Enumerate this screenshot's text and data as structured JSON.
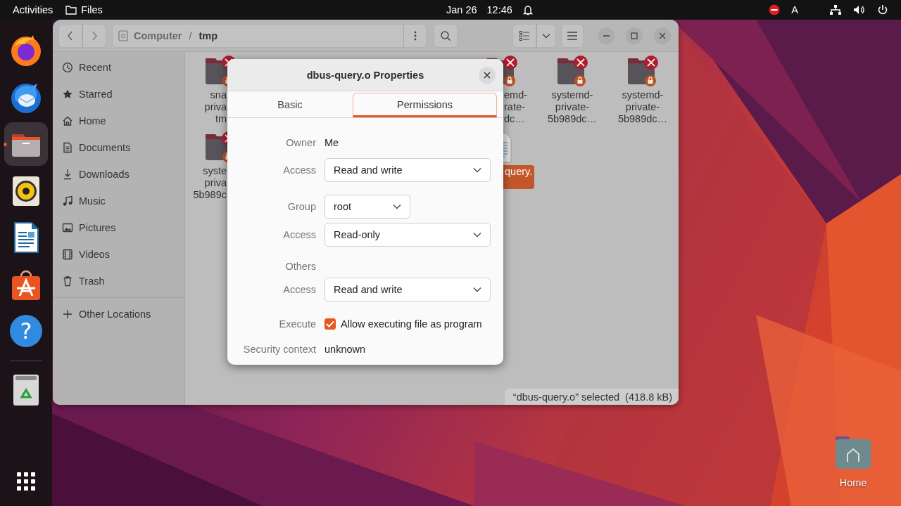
{
  "top_bar": {
    "activities": "Activities",
    "app_name": "Files",
    "date": "Jan 26",
    "time": "12:46",
    "input_source": "A"
  },
  "dock": {
    "apps": [
      {
        "kind": "firefox",
        "running": false,
        "focused": false
      },
      {
        "kind": "thunderbird",
        "running": false,
        "focused": false
      },
      {
        "kind": "files",
        "running": true,
        "focused": true
      },
      {
        "kind": "rhythmbox",
        "running": false,
        "focused": false
      },
      {
        "kind": "writer",
        "running": false,
        "focused": false
      },
      {
        "kind": "software",
        "running": false,
        "focused": false
      },
      {
        "kind": "help",
        "glyph": "?",
        "running": false,
        "focused": false
      }
    ],
    "trash": {
      "kind": "trash",
      "running": false,
      "focused": false
    }
  },
  "files_window": {
    "path": {
      "crumbs": [
        "Computer",
        "tmp"
      ],
      "separator": "/"
    },
    "sidebar": [
      {
        "label": "Recent"
      },
      {
        "label": "Starred"
      },
      {
        "label": "Home"
      },
      {
        "label": "Documents"
      },
      {
        "label": "Downloads"
      },
      {
        "label": "Music"
      },
      {
        "label": "Pictures"
      },
      {
        "label": "Videos"
      },
      {
        "label": "Trash"
      }
    ],
    "other_locations": {
      "label": "Other Locations"
    },
    "items": [
      {
        "kind": "folder",
        "lines": [
          "sna",
          "priva",
          "tm"
        ],
        "selected": false
      },
      {
        "kind": "folder",
        "lines": [
          "emd-",
          "rate-",
          "dc…"
        ],
        "selected": false
      },
      {
        "kind": "folder",
        "lines": [
          "systemd-",
          "private-",
          "5b989dc…"
        ],
        "selected": false
      },
      {
        "kind": "folder",
        "lines": [
          "systemd-",
          "private-",
          "5b989dc…"
        ],
        "selected": false
      },
      {
        "kind": "folder",
        "lines": [
          "syste",
          "priva",
          "5b989c"
        ],
        "selected": false
      },
      {
        "kind": "document",
        "lines": [
          "query."
        ],
        "selected": true
      }
    ],
    "status": "“dbus-query.o” selected  (418.8 kB)"
  },
  "dialog": {
    "title": "dbus-query.o Properties",
    "tabs": [
      {
        "label": "Basic",
        "selected": false
      },
      {
        "label": "Permissions",
        "selected": true
      }
    ],
    "sections": [
      {
        "rows": [
          {
            "kind": "text",
            "label": "Owner",
            "value": "Me"
          },
          {
            "kind": "dropdown",
            "label": "Access",
            "value": "Read and write"
          }
        ]
      },
      {
        "rows": [
          {
            "kind": "short-dropdown",
            "label": "Group",
            "value": "root"
          },
          {
            "kind": "dropdown",
            "label": "Access",
            "value": "Read-only"
          }
        ]
      },
      {
        "rows": [
          {
            "kind": "heading",
            "label": "Others"
          },
          {
            "kind": "dropdown",
            "label": "Access",
            "value": "Read and write"
          }
        ]
      },
      {
        "rows": [
          {
            "kind": "checkbox",
            "label": "Execute",
            "value": "Allow executing file as program",
            "checked": true
          },
          {
            "kind": "text",
            "label": "Security context",
            "value": "unknown"
          }
        ]
      }
    ]
  },
  "desktop": {
    "home_label": "Home"
  }
}
